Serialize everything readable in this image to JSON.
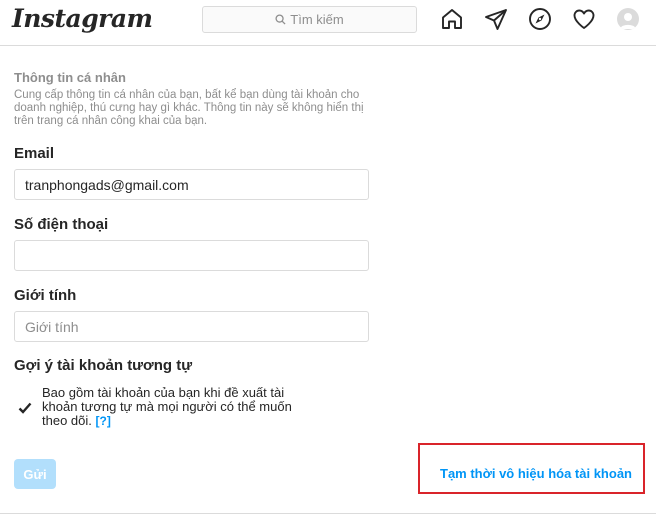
{
  "header": {
    "logo": "Instagram",
    "search_placeholder": "Tìm kiếm"
  },
  "personal_info": {
    "title": "Thông tin cá nhân",
    "description": "Cung cấp thông tin cá nhân của bạn, bất kể bạn dùng tài khoản cho doanh nghiệp, thú cưng hay gì khác. Thông tin này sẽ không hiển thị trên trang cá nhân công khai của bạn."
  },
  "form": {
    "email_label": "Email",
    "email_value": "tranphongads@gmail.com",
    "phone_label": "Số điện thoại",
    "phone_value": "",
    "gender_label": "Giới tính",
    "gender_placeholder": "Giới tính",
    "suggest_label": "Gợi ý tài khoản tương tự",
    "suggest_text": "Bao gồm tài khoản của bạn khi đề xuất tài khoản tương tự mà mọi người có thể muốn theo dõi.",
    "help_link": "[?]",
    "suggest_checked": true,
    "submit_label": "Gửi"
  },
  "deactivate_label": "Tạm thời vô hiệu hóa tài khoản",
  "colors": {
    "link": "#0095f6",
    "highlight_box": "#d9242a",
    "submit_disabled": "#b2dffc"
  }
}
